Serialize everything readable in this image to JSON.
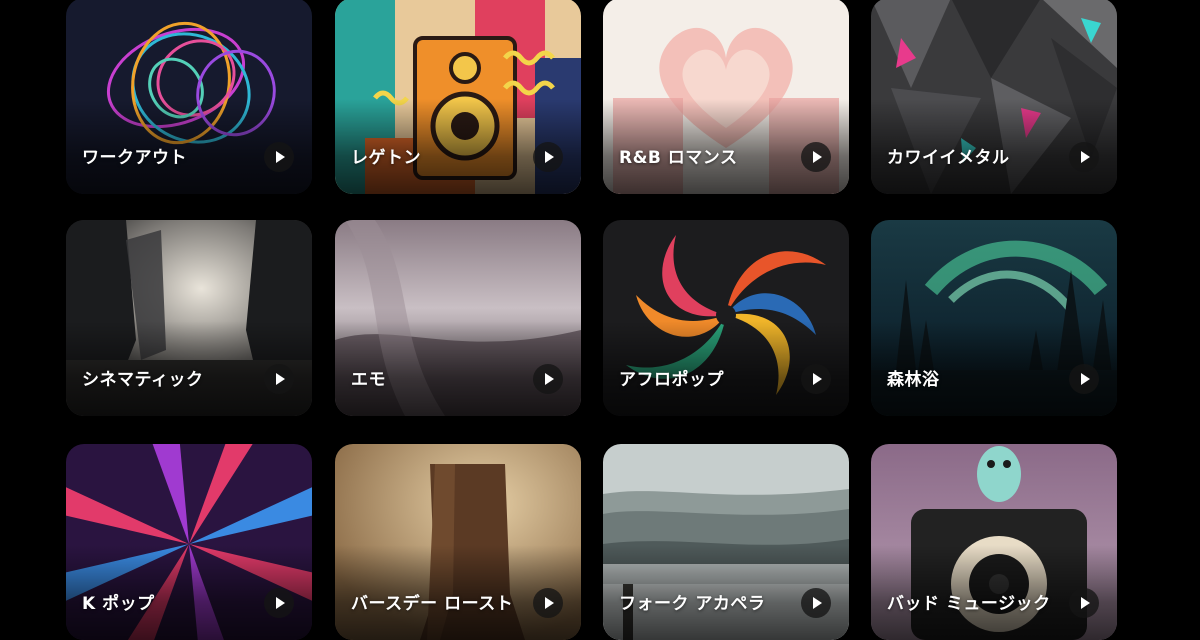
{
  "cards": [
    {
      "label": "ワークアウト",
      "image": "neon-spiral-rings"
    },
    {
      "label": "レゲトン",
      "image": "retro-speaker-poster"
    },
    {
      "label": "R&B ロマンス",
      "image": "watercolor-heart-hands"
    },
    {
      "label": "カワイイメタル",
      "image": "grunge-metal-collage"
    },
    {
      "label": "シネマティック",
      "image": "misty-canyon-light"
    },
    {
      "label": "エモ",
      "image": "hazy-mauve-sky"
    },
    {
      "label": "アフロポップ",
      "image": "colorful-pinwheel"
    },
    {
      "label": "森林浴",
      "image": "aurora-forest"
    },
    {
      "label": "K ポップ",
      "image": "neon-starburst"
    },
    {
      "label": "バースデー ロースト",
      "image": "dusty-boot"
    },
    {
      "label": "フォーク アカペラ",
      "image": "misty-hills"
    },
    {
      "label": "バッド ミュージック",
      "image": "bird-on-speaker"
    }
  ],
  "play_icon": "play-icon"
}
